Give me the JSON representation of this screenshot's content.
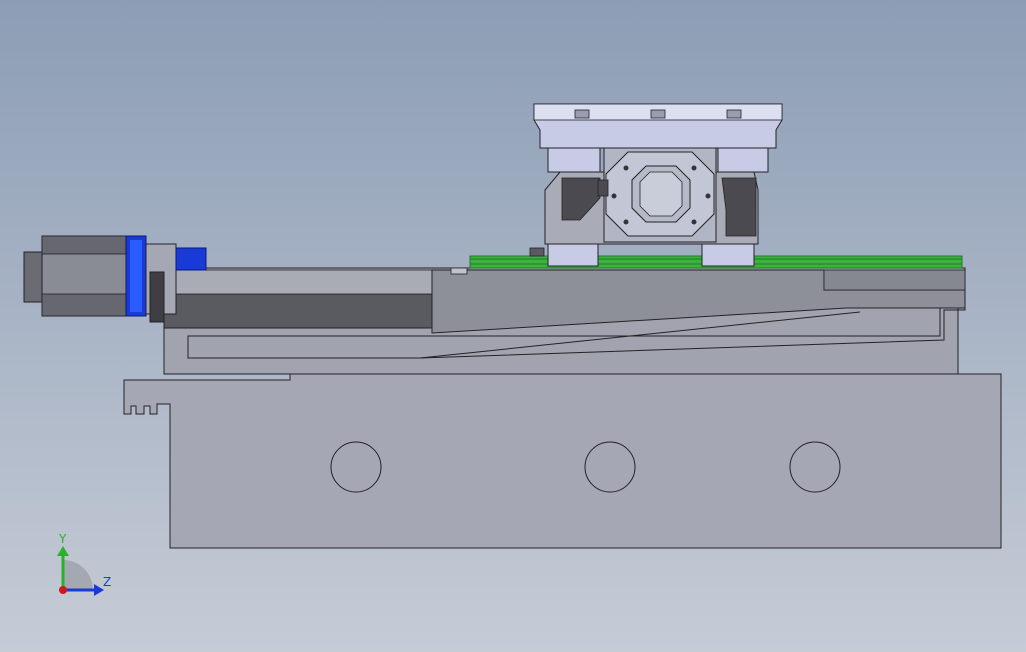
{
  "viewport": {
    "background_top": "#8c9db5",
    "background_bottom": "#c6ccd6"
  },
  "colors": {
    "base_fill": "#a4a7b2",
    "base_dark": "#5a5a61",
    "base_mid": "#8c8e98",
    "outline": "#222226",
    "rail_green": "#3db23d",
    "rail_green_dark": "#1f7a2a",
    "motor_blue": "#1a3ad8",
    "motor_blue_light": "#2a5cff",
    "table_light": "#c8cbe6",
    "table_lighter": "#dcdff2",
    "triad_y": "#2ab02a",
    "triad_z": "#1a3ad8",
    "triad_origin": "#d01818"
  },
  "triad": {
    "y_label": "Y",
    "z_label": "Z",
    "y_icon": "y-axis-arrow-icon",
    "z_icon": "z-axis-arrow-icon"
  }
}
